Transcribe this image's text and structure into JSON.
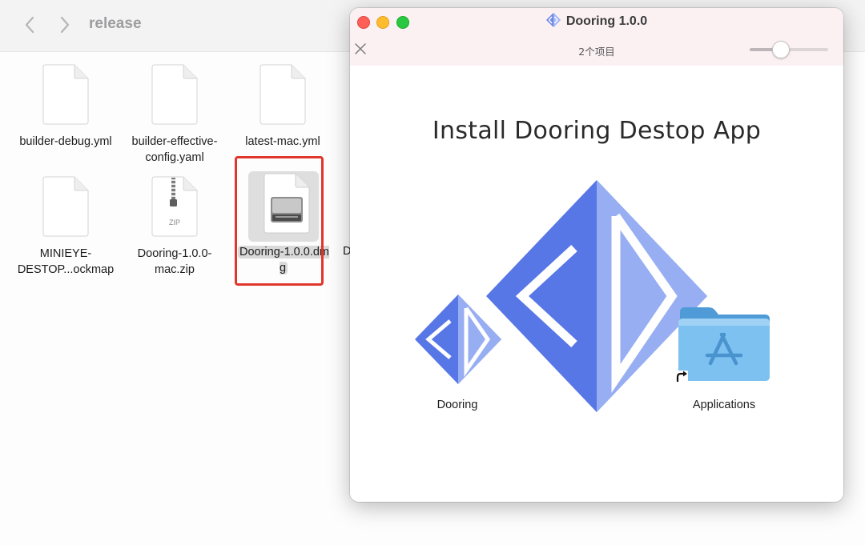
{
  "finder": {
    "title": "release",
    "files": [
      {
        "name": "builder-debug.yml",
        "kind": "document"
      },
      {
        "name": "builder-effective-\nconfig.yaml",
        "kind": "document"
      },
      {
        "name": "latest-mac.yml",
        "kind": "document"
      },
      {
        "name": "MINIEYE-\nDESTOP...ockmap",
        "kind": "document"
      },
      {
        "name": "Dooring-1.0.0-\nmac.zip",
        "kind": "zip",
        "badge": "ZIP"
      },
      {
        "name": "Dooring-1.0.0.dm\ng",
        "kind": "disk-image",
        "selected": true,
        "highlighted": true
      }
    ],
    "cut_off_label": "D"
  },
  "dmg_window": {
    "title": "Dooring 1.0.0",
    "item_count": "2个项目",
    "icon_size_slider": 0.39,
    "heading": "Install Dooring Destop App",
    "items": [
      {
        "label": "Dooring",
        "icon": "dooring-app-icon"
      },
      {
        "label": "Applications",
        "icon": "applications-folder-icon"
      }
    ]
  },
  "colors": {
    "highlight_box": "#e0362b",
    "logo_dark": "#5877e6",
    "logo_light": "#98aef3",
    "folder_blue": "#68b4ea"
  }
}
